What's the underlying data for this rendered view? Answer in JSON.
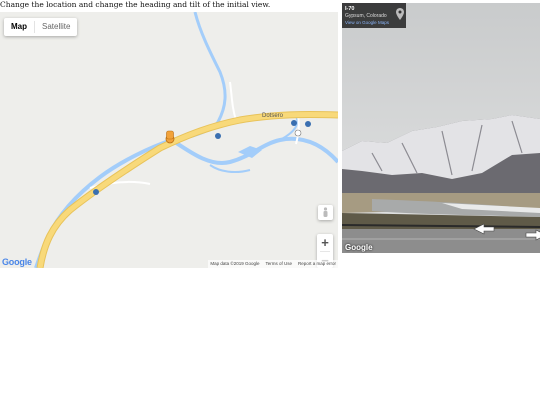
{
  "instruction": "Change the location and change the heading and tilt of the initial view.",
  "map": {
    "type_buttons": [
      "Map",
      "Satellite"
    ],
    "active_type": "Map",
    "town_label": "Dotsero",
    "zoom_in": "+",
    "zoom_out": "−",
    "footer": {
      "data": "Map data ©2019 Google",
      "terms": "Terms of Use",
      "report": "Report a map error"
    },
    "logo": "Google",
    "colors": {
      "land": "#eeeeeb",
      "river": "#a3cdfa",
      "highway": "#f8d97a",
      "marker": "#f2a23a"
    },
    "icons": [
      "pegman-icon",
      "street-view-marker-icon",
      "interstate-shield-icon"
    ]
  },
  "pano": {
    "road": "I-70",
    "place": "Gypsum, Colorado",
    "link": "View on Google Maps",
    "logo": "Google",
    "icons": [
      "map-pin-icon",
      "nav-arrow-left-icon",
      "nav-arrow-right-icon"
    ]
  }
}
